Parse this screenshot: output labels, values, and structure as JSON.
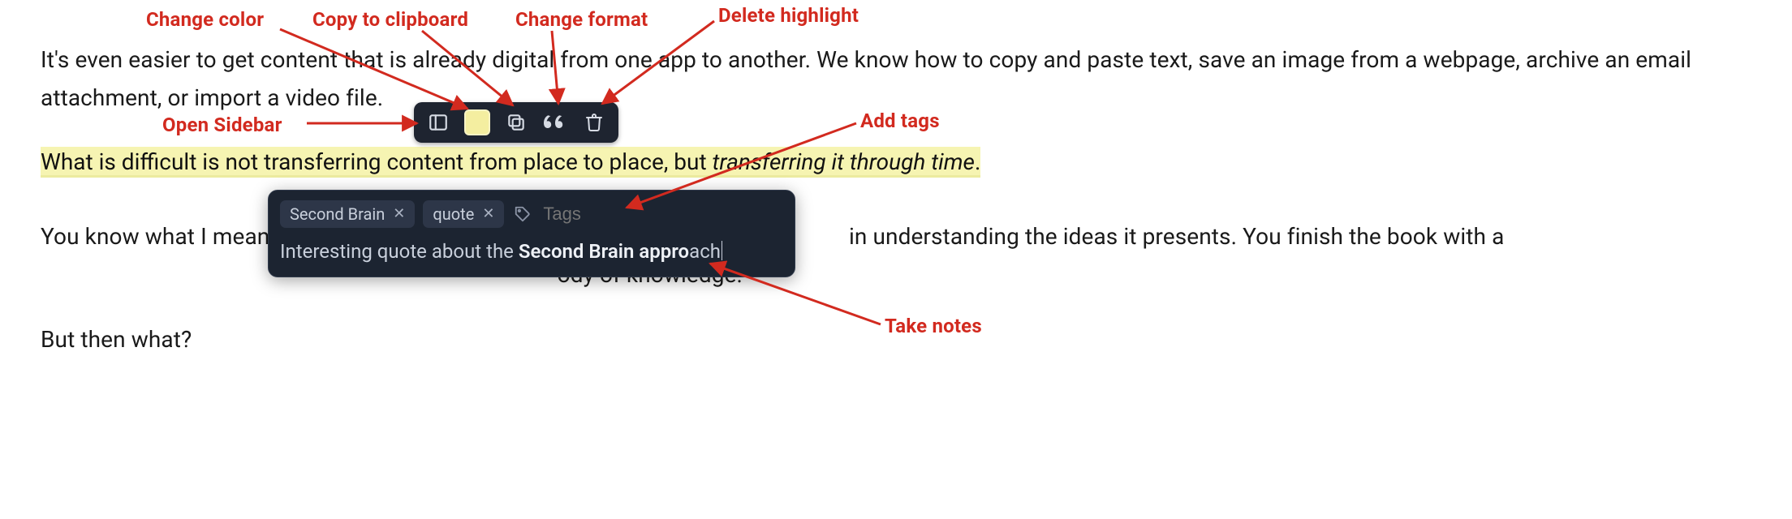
{
  "paragraphs": {
    "p1": "It's even easier to get content that is already digital from one app to another. We know how to copy and paste text, save an image from a webpage, archive an email attachment, or import a video file.",
    "highlight_plain": "What is difficult is not transferring content from place to place, but ",
    "highlight_italic": "transferring it through time",
    "highlight_tail": ".",
    "p3a": "You know what I mean",
    "p3b": " in understanding the ideas it presents. You finish the book with a",
    "p3c": "ody of knowledge.",
    "p4": "But then what?"
  },
  "toolbar": {
    "swatch_color": "#f4eea0"
  },
  "note_panel": {
    "tags": [
      {
        "label": "Second Brain"
      },
      {
        "label": "quote"
      }
    ],
    "tag_placeholder": "Tags",
    "note_plain_1": "Interesting quote about the ",
    "note_bold_1": "Second Brain appro",
    "note_plain_2": "ach"
  },
  "annotations": {
    "open_sidebar": "Open Sidebar",
    "change_color": "Change color",
    "copy": "Copy to clipboard",
    "change_format": "Change format",
    "delete_highlight": "Delete highlight",
    "add_tags": "Add tags",
    "take_notes": "Take notes"
  },
  "colors": {
    "annotation": "#d22a1f",
    "highlight_bg": "#f6f4b2",
    "panel_bg": "#1c2431",
    "toolbar_bg": "#1e2430"
  }
}
